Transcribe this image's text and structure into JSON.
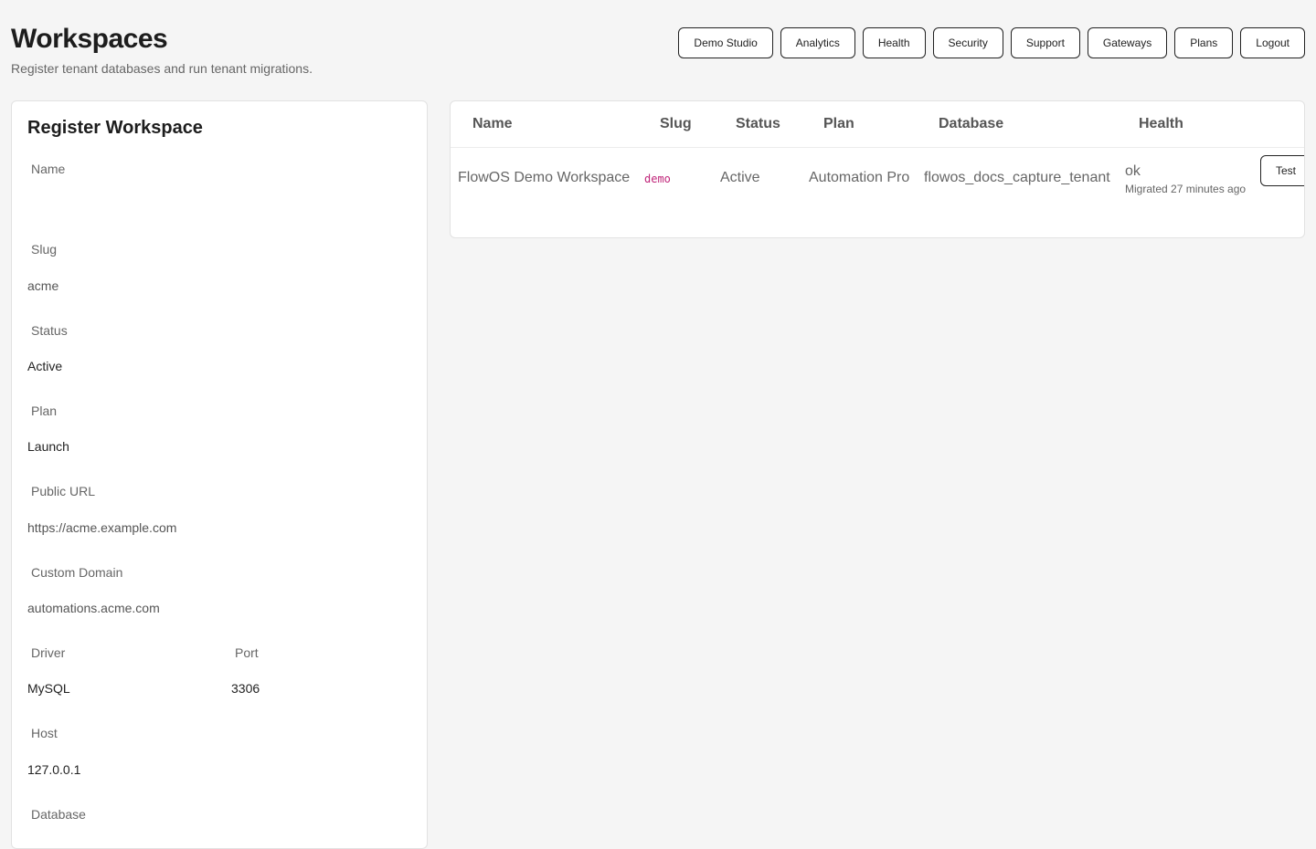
{
  "header": {
    "title": "Workspaces",
    "subtitle": "Register tenant databases and run tenant migrations."
  },
  "nav": {
    "demo_studio": "Demo Studio",
    "analytics": "Analytics",
    "health": "Health",
    "security": "Security",
    "support": "Support",
    "gateways": "Gateways",
    "plans": "Plans",
    "logout": "Logout"
  },
  "form": {
    "title": "Register Workspace",
    "name_label": "Name",
    "name_value": "",
    "slug_label": "Slug",
    "slug_placeholder": "acme",
    "status_label": "Status",
    "status_value": "Active",
    "plan_label": "Plan",
    "plan_value": "Launch",
    "public_url_label": "Public URL",
    "public_url_placeholder": "https://acme.example.com",
    "custom_domain_label": "Custom Domain",
    "custom_domain_placeholder": "automations.acme.com",
    "driver_label": "Driver",
    "driver_value": "MySQL",
    "port_label": "Port",
    "port_value": "3306",
    "host_label": "Host",
    "host_value": "127.0.0.1",
    "database_label": "Database"
  },
  "table": {
    "headers": {
      "name": "Name",
      "slug": "Slug",
      "status": "Status",
      "plan": "Plan",
      "database": "Database",
      "health": "Health"
    },
    "rows": [
      {
        "name": "FlowOS Demo Workspace",
        "slug": "demo",
        "status": "Active",
        "plan": "Automation Pro",
        "database": "flowos_docs_capture_tenant",
        "health": "ok",
        "migrated": "Migrated 27 minutes ago",
        "action": "Test"
      }
    ]
  },
  "colors": {
    "background": "#f5f5f5",
    "slug_accent": "#c0267a"
  }
}
